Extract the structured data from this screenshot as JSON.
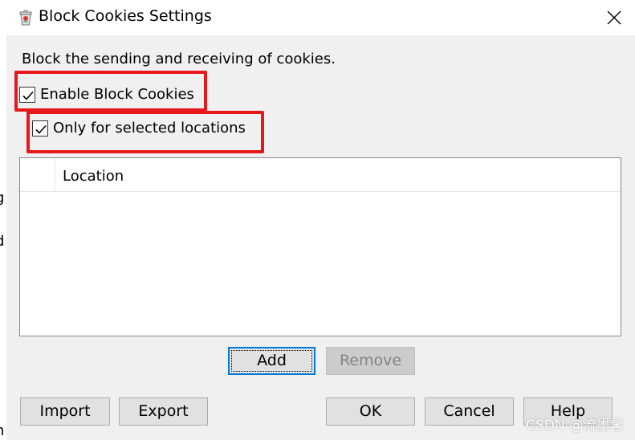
{
  "background_window": {
    "fragments": [
      "g",
      "d",
      "n"
    ]
  },
  "dialog": {
    "title": "Block Cookies Settings",
    "description": "Block the sending and receiving of cookies."
  },
  "options": {
    "enable_block_cookies": {
      "label": "Enable Block Cookies",
      "checked": true
    },
    "only_selected_locations": {
      "label": "Only for selected locations",
      "checked": true
    }
  },
  "table": {
    "columns": [
      "",
      "Location"
    ],
    "rows": []
  },
  "buttons": {
    "add": "Add",
    "remove": "Remove",
    "import": "Import",
    "export": "Export",
    "ok": "OK",
    "cancel": "Cancel",
    "help": "Help"
  },
  "watermark": "CSDN @流墨馨",
  "colors": {
    "highlight": "#e8171c",
    "focus_border": "#0078d7",
    "button_face": "#e1e1e1",
    "disabled_face": "#cccccc"
  }
}
